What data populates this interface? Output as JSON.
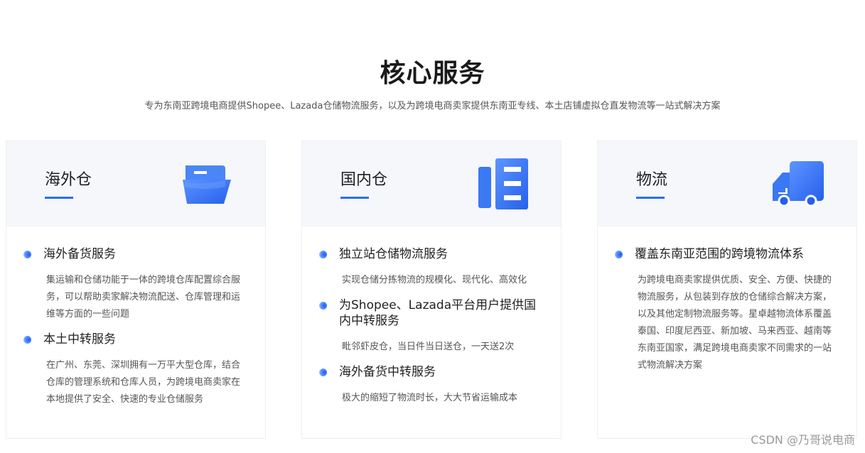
{
  "header": {
    "title": "核心服务",
    "subtitle": "专为东南亚跨境电商提供Shopee、Lazada仓储物流服务，以及为跨境电商卖家提供东南亚专线、本土店铺虚拟仓直发物流等一站式解决方案"
  },
  "cards": [
    {
      "title": "海外仓",
      "icon": "folder-icon",
      "items": [
        {
          "title": "海外备货服务",
          "desc": "集运输和仓储功能于一体的跨境仓库配置综合服务，可以帮助卖家解决物流配送、仓库管理和运维等方面的一些问题"
        },
        {
          "title": "本土中转服务",
          "desc": "在广州、东莞、深圳拥有一万平大型仓库，结合仓库的管理系统和仓库人员，为跨境电商卖家在本地提供了安全、快速的专业仓储服务"
        }
      ]
    },
    {
      "title": "国内仓",
      "icon": "warehouse-shelf-icon",
      "items": [
        {
          "title": "独立站仓储物流服务",
          "desc": "实现仓储分拣物流的规模化、现代化、高效化"
        },
        {
          "title": "为Shopee、Lazada平台用户提供国内中转服务",
          "desc": "毗邻虾皮仓，当日件当日送仓，一天送2次"
        },
        {
          "title": "海外备货中转服务",
          "desc": "极大的缩短了物流时长，大大节省运输成本"
        }
      ]
    },
    {
      "title": "物流",
      "icon": "truck-icon",
      "items": [
        {
          "title": "覆盖东南亚范围的跨境物流体系",
          "desc": "为跨境电商卖家提供优质、安全、方便、快捷的物流服务，从包装到存放的仓储综合解决方案，以及其他定制物流服务等。星卓越物流体系覆盖泰国、印度尼西亚、新加坡、马来西亚、越南等东南亚国家，满足跨境电商卖家不同需求的一站式物流解决方案"
        }
      ]
    }
  ],
  "watermark": "CSDN @乃哥说电商",
  "colors": {
    "accent": "#2b6df0",
    "head_bg": "#f5f7fb"
  }
}
